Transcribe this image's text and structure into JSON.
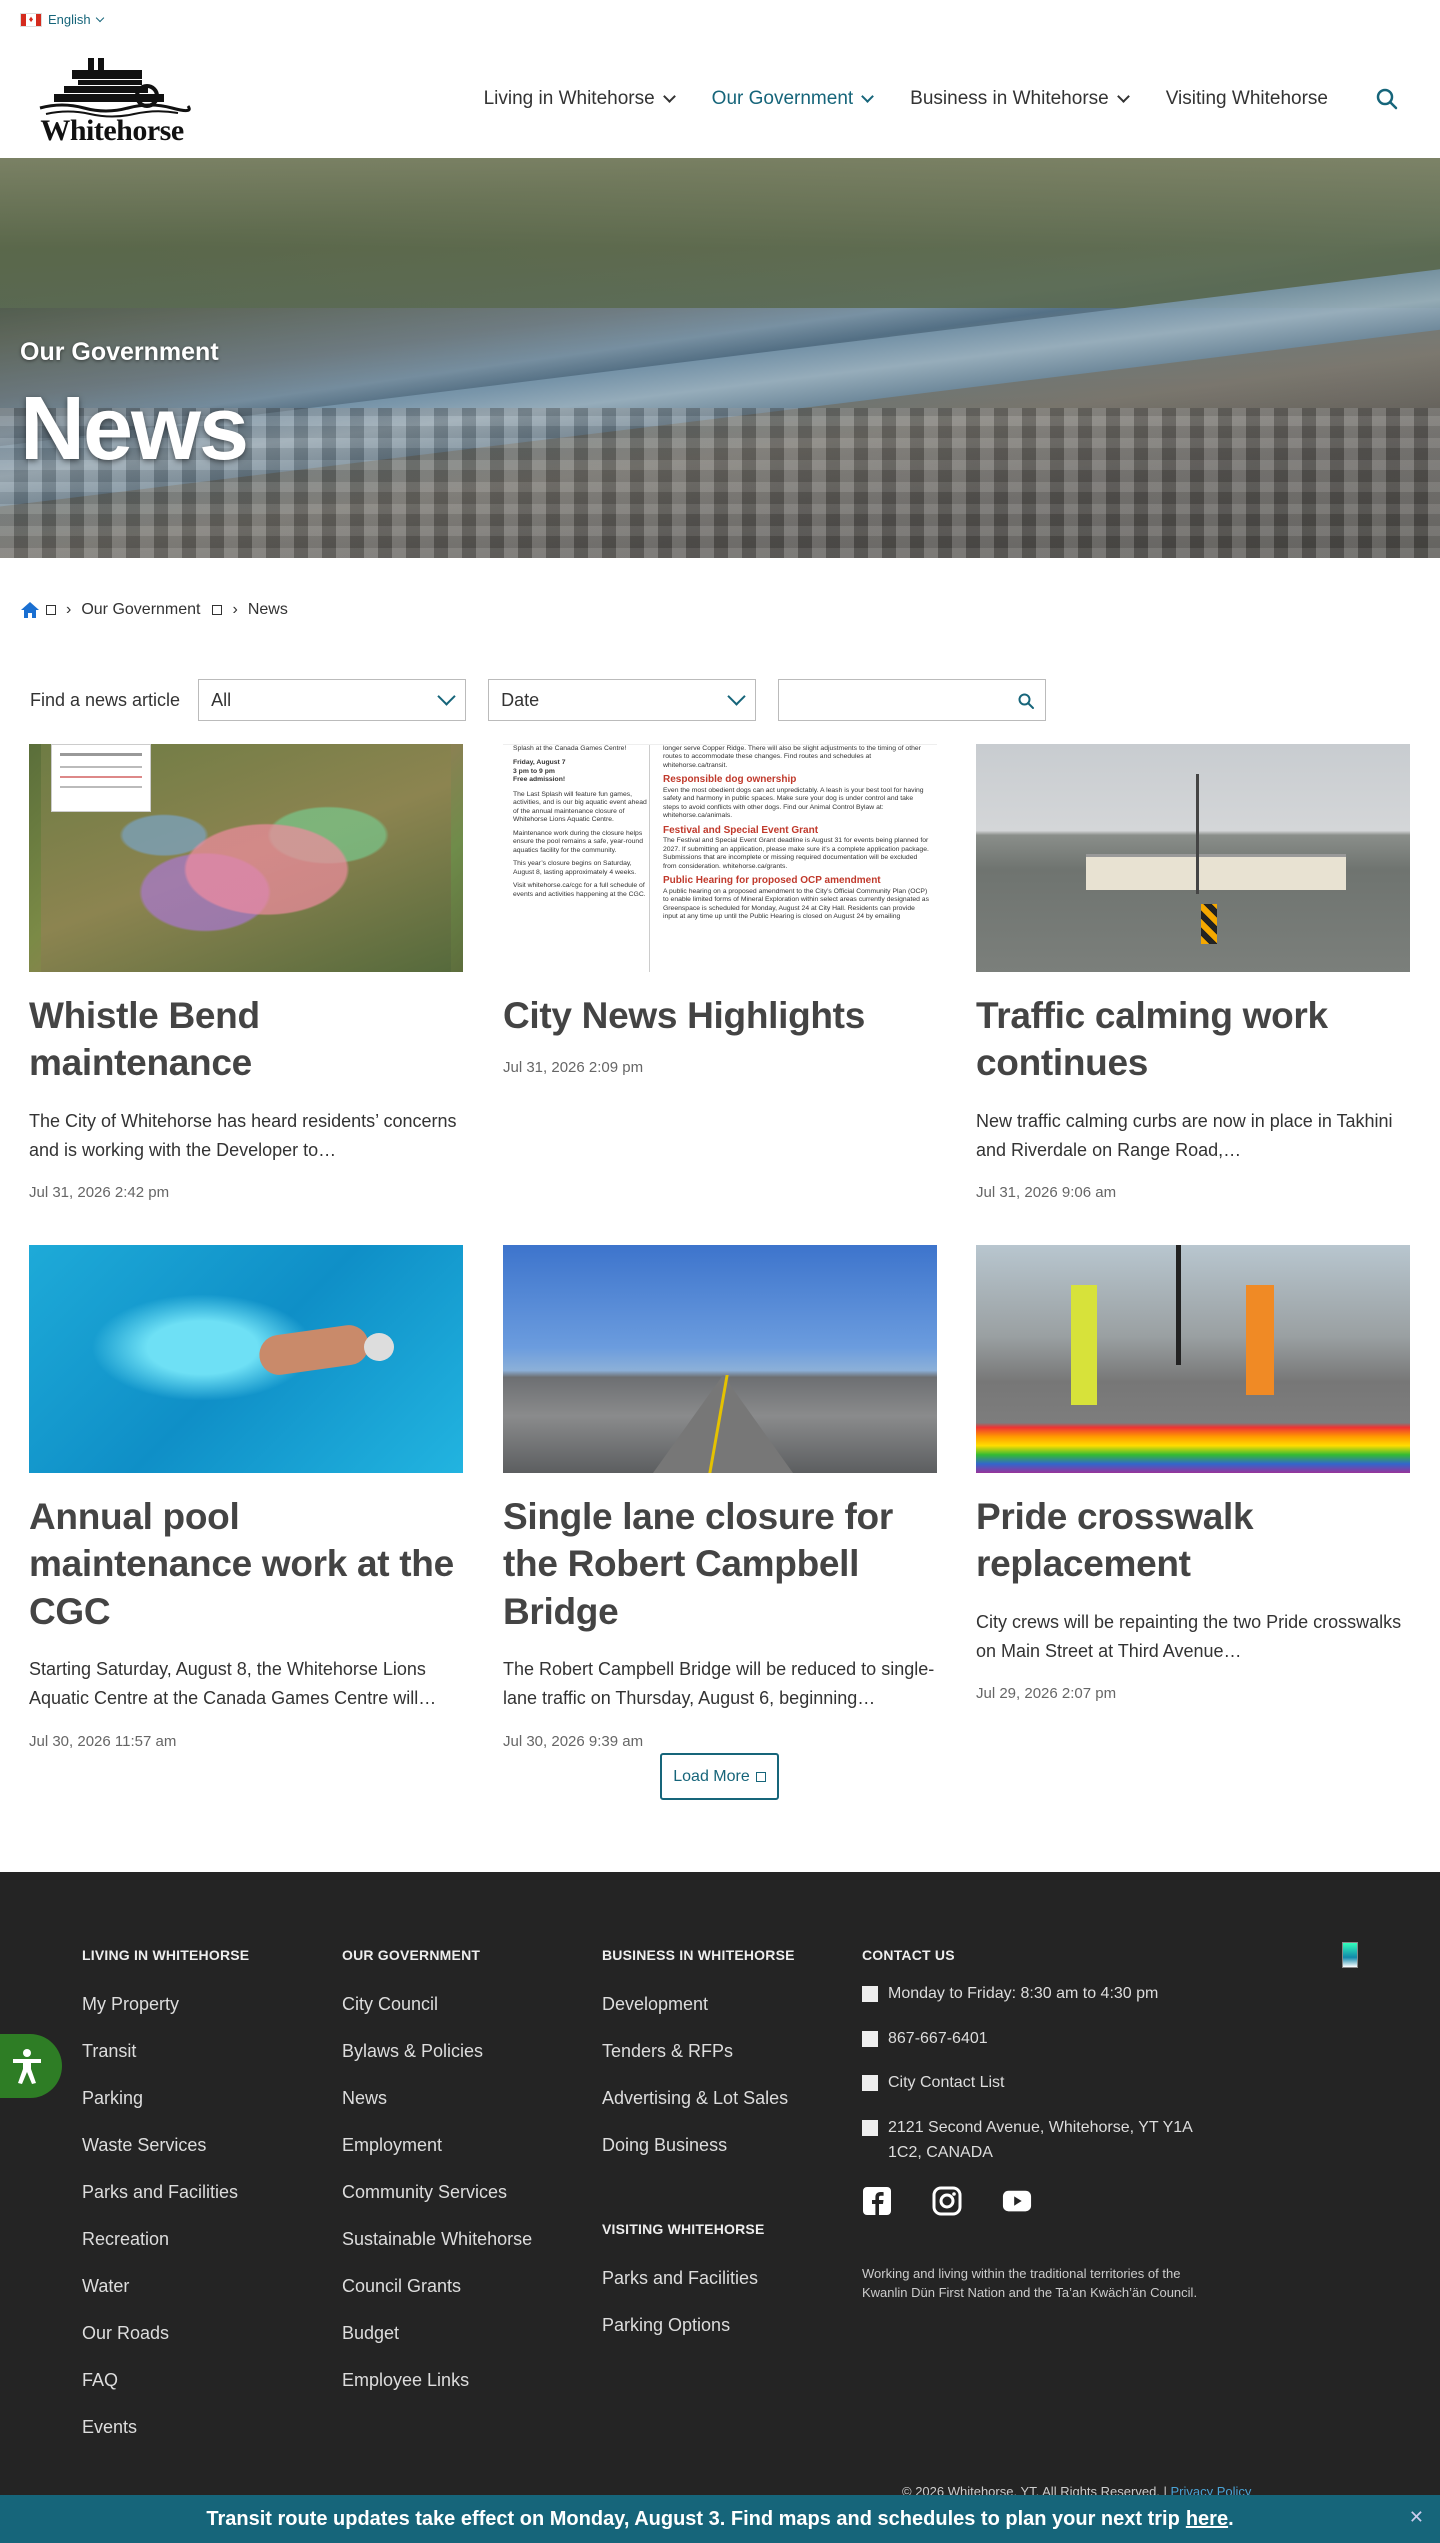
{
  "language": {
    "label": "English"
  },
  "brand": {
    "name": "Whitehorse"
  },
  "nav": {
    "items": [
      {
        "label": "Living in Whitehorse",
        "has_dropdown": true,
        "active": false
      },
      {
        "label": "Our Government",
        "has_dropdown": true,
        "active": true
      },
      {
        "label": "Business in Whitehorse",
        "has_dropdown": true,
        "active": false
      },
      {
        "label": "Visiting Whitehorse",
        "has_dropdown": false,
        "active": false
      }
    ],
    "search_icon": "search-icon"
  },
  "hero": {
    "subtitle": "Our Government",
    "title": "News"
  },
  "breadcrumb": {
    "home_icon": "home-icon",
    "items": [
      "Our Government",
      "News"
    ]
  },
  "filter": {
    "label": "Find a news article",
    "category": "All",
    "date": "Date",
    "search_placeholder": ""
  },
  "articles": [
    {
      "title": "Whistle Bend maintenance",
      "desc": "The City of Whitehorse has heard residents’ concerns and is working with the Developer to…",
      "date": "Jul 31, 2026 2:42 pm"
    },
    {
      "title": "City News Highlights",
      "desc": "",
      "date": "Jul 31, 2026 2:09 pm"
    },
    {
      "title": "Traffic calming work continues",
      "desc": "New traffic calming curbs are now in place in Takhini and Riverdale on Range Road,…",
      "date": "Jul 31, 2026 9:06 am"
    },
    {
      "title": "Annual pool maintenance work at the CGC",
      "desc": "Starting Saturday, August 8, the Whitehorse Lions Aquatic Centre at the Canada Games Centre will…",
      "date": "Jul 30, 2026 11:57 am"
    },
    {
      "title": "Single lane closure for the Robert Campbell Bridge",
      "desc": "The Robert Campbell Bridge will be reduced to single-lane traffic on Thursday, August 6, beginning…",
      "date": "Jul 30, 2026 9:39 am"
    },
    {
      "title": "Pride crosswalk replacement",
      "desc": "City crews will be repainting the two Pride crosswalks on Main Street at Third Avenue…",
      "date": "Jul 29, 2026 2:07 pm"
    }
  ],
  "doc_thumb": {
    "left": [
      "Splash at the Canada Games Centre!",
      "Friday, August 7",
      "3 pm to 9 pm",
      "Free admission!",
      "The Last Splash will feature fun games, activities, and is our big aquatic event ahead of the annual maintenance closure of Whitehorse Lions Aquatic Centre.",
      "Maintenance work during the closure helps ensure the pool remains a safe, year-round aquatics facility for the community.",
      "This year’s closure begins on Saturday, August 8, lasting approximately 4 weeks.",
      "Visit whitehorse.ca/cgc for a full schedule of events and activities happening at the CGC."
    ],
    "right_headings": [
      "Responsible dog ownership",
      "Festival and Special Event Grant",
      "Public Hearing for proposed OCP amendment"
    ],
    "right_paras": [
      "Even the most obedient dogs can act unpredictably. A leash is your best tool for having safety and harmony in public spaces. Make sure your dog is under control and take steps to avoid conflicts with other dogs. Find our Animal Control Bylaw at: whitehorse.ca/animals.",
      "The Festival and Special Event Grant deadline is August 31 for events being planned for 2027. If submitting an application, please make sure it’s a complete application package. Submissions that are incomplete or missing required documentation will be excluded from consideration. whitehorse.ca/grants.",
      "A public hearing on a proposed amendment to the City’s Official Community Plan (OCP) to enable limited forms of Mineral Exploration within select areas currently designated as Greenspace is scheduled for Monday, August 24 at City Hall. Residents can provide input at any time up until the Public Hearing is closed on August 24 by emailing"
    ],
    "top_text": "longer serve Copper Ridge. There will also be slight adjustments to the timing of other routes to accommodate these changes. Find routes and schedules at whitehorse.ca/transit."
  },
  "load_more": "Load More",
  "footer": {
    "living": {
      "heading": "Living in Whitehorse",
      "links": [
        "My Property",
        "Transit",
        "Parking",
        "Waste Services",
        "Parks and Facilities",
        "Recreation",
        "Water",
        "Our Roads",
        "FAQ",
        "Events"
      ]
    },
    "government": {
      "heading": "Our Government",
      "links": [
        "City Council",
        "Bylaws & Policies",
        "News",
        "Employment",
        "Community Services",
        "Sustainable Whitehorse",
        "Council Grants",
        "Budget",
        "Employee Links"
      ]
    },
    "business": {
      "heading": "Business in Whitehorse",
      "links": [
        "Development",
        "Tenders & RFPs",
        "Advertising & Lot Sales",
        "Doing Business"
      ]
    },
    "visiting": {
      "heading": "Visiting Whitehorse",
      "links": [
        "Parks and Facilities",
        "Parking Options"
      ]
    },
    "contact": {
      "heading": "Contact Us",
      "hours": "Monday to Friday: 8:30 am to 4:30 pm",
      "phone": "867-667-6401",
      "list": "City Contact List",
      "address": "2121 Second Avenue, Whitehorse, YT Y1A 1C2, CANADA"
    },
    "social": [
      "facebook-icon",
      "instagram-icon",
      "youtube-icon"
    ],
    "acknowledgement": "Working and living within the traditional territories of the Kwanlin Dün First Nation and the Ta’an Kwäch’än Council.",
    "copyright": "© 2026 Whitehorse, YT. All Rights Reserved.",
    "privacy": "Privacy Policy"
  },
  "alert": {
    "text": "Transit route updates take effect on Monday, August 3. Find maps and schedules to plan your next trip",
    "link": "here",
    "close": "✕"
  },
  "colors": {
    "accent": "#16657a",
    "footer_bg": "#242424",
    "a11y": "#2e7d25"
  }
}
